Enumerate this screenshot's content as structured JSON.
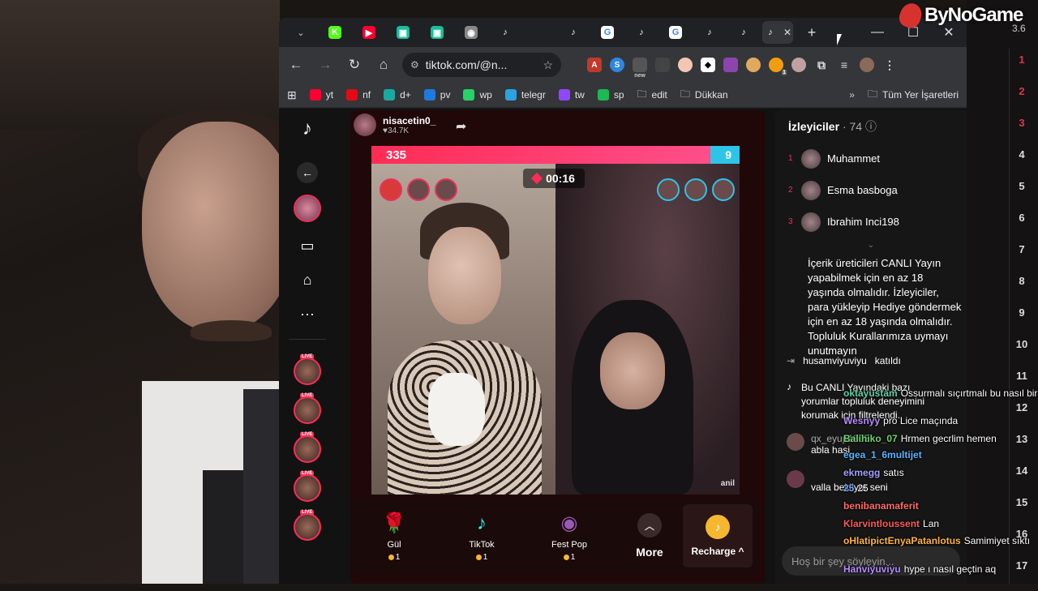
{
  "overlay_brand": "ByNoGame",
  "right_strip": {
    "header": "3.6",
    "ranks": [
      "1",
      "2",
      "3",
      "4",
      "5",
      "6",
      "7",
      "8",
      "9",
      "10",
      "11",
      "12",
      "13",
      "14",
      "15",
      "16",
      "17"
    ]
  },
  "browser": {
    "tabs": [
      {
        "icon": "kick-icon",
        "active": false
      },
      {
        "icon": "youtube-icon",
        "active": false
      },
      {
        "icon": "app-icon",
        "active": false
      },
      {
        "icon": "app-icon",
        "active": false
      },
      {
        "icon": "chrome-icon",
        "active": false
      },
      {
        "icon": "tiktok-icon",
        "active": false
      },
      {
        "icon": "blank",
        "active": false
      },
      {
        "icon": "tiktok-icon",
        "active": false
      },
      {
        "icon": "google-icon",
        "active": false
      },
      {
        "icon": "tiktok-icon",
        "active": false
      },
      {
        "icon": "google-icon",
        "active": false
      },
      {
        "icon": "tiktok-icon",
        "active": false
      },
      {
        "icon": "tiktok-icon",
        "active": false
      },
      {
        "icon": "tiktok-icon",
        "active": true
      }
    ],
    "url": "tiktok.com/@n...",
    "ext_badge_new": "new",
    "ext_badge_count": "1",
    "bookmarks": [
      {
        "label": "yt",
        "color": "#ff0033"
      },
      {
        "label": "nf",
        "color": "#e50914"
      },
      {
        "label": "d+",
        "color": "#1aa9a0"
      },
      {
        "label": "pv",
        "color": "#1f7ae0"
      },
      {
        "label": "wp",
        "color": "#25d366"
      },
      {
        "label": "telegr",
        "color": "#2aa3e0"
      },
      {
        "label": "tw",
        "color": "#9146ff"
      },
      {
        "label": "sp",
        "color": "#1db954"
      },
      {
        "label": "edit",
        "color": "folder"
      },
      {
        "label": "Dükkan",
        "color": "folder"
      }
    ],
    "all_bookmarks": "Tüm Yer İşaretleri"
  },
  "stream": {
    "username": "nisacetin0_",
    "likes": "♥34.7K",
    "score_left": "335",
    "score_right": "9",
    "timer": "00:16",
    "watermark": "anil",
    "gifts": [
      {
        "name": "Gül",
        "price": "1",
        "icon": "rose-icon"
      },
      {
        "name": "TikTok",
        "price": "1",
        "icon": "tiktok-gift-icon"
      },
      {
        "name": "Fest Pop",
        "price": "1",
        "icon": "fest-pop-icon"
      }
    ],
    "more_label": "More",
    "recharge_label": "Recharge"
  },
  "chat": {
    "title": "İzleyiciler",
    "count": "· 74",
    "top_viewers": [
      {
        "rank": "1",
        "name": "Muhammet"
      },
      {
        "rank": "2",
        "name": "Esma basboga"
      },
      {
        "rank": "3",
        "name": "Ibrahim Inci198"
      }
    ],
    "notice": "İçerik üreticileri CANLI Yayın yapabilmek için en az 18 yaşında olmalıdır. İzleyiciler, para yükleyip Hediye göndermek için en az 18 yaşında olmalıdır. Topluluk Kurallarımıza uymayı unutmayın",
    "joined_user": "husamviyuviyu",
    "joined_text": "katıldı",
    "system_msg": "Bu CANLI Yayındaki bazı yorumlar topluluk deneyimini korumak için filtrelendi.",
    "bg_user": "qx_eyup1805",
    "bg_msg1": "abla hasi",
    "bg_msg2": "valla bekliyor seni",
    "input_placeholder": "Hoş bir şey söyleyin..."
  },
  "overlay_chat": [
    {
      "user": "oktayustam",
      "msg": "Ossurmalı sıçırtmalı bu nasıl bir canlı",
      "color": "#5fd3a8"
    },
    {
      "user": "Wesnyy",
      "msg": "pro Lice maçında",
      "color": "#b48cff"
    },
    {
      "user": "Balihiko_07",
      "msg": "Hrmen gecrlim hemen",
      "color": "#6fd36f"
    },
    {
      "user": "egea_1_6multijet",
      "msg": "",
      "color": "#5ab4ff"
    },
    {
      "user": "ekmegg",
      "msg": "satıs",
      "color": "#a0a0ff"
    },
    {
      "user": "25",
      "msg": "25",
      "color": "#6fa0ff"
    },
    {
      "user": "benibanamaferit",
      "msg": "",
      "color": "#ff6a6a"
    },
    {
      "user": "Klarvintloussent",
      "msg": "Lan",
      "color": "#ff5a5a"
    },
    {
      "user": "oHlatipictEnyaPatanlotus",
      "msg": "Samimiyet sıktı",
      "color": "#ffb347"
    },
    {
      "user": "Hanviyuviyu",
      "msg": "hype ı nasıl geçtin aq",
      "color": "#b48cff"
    }
  ]
}
